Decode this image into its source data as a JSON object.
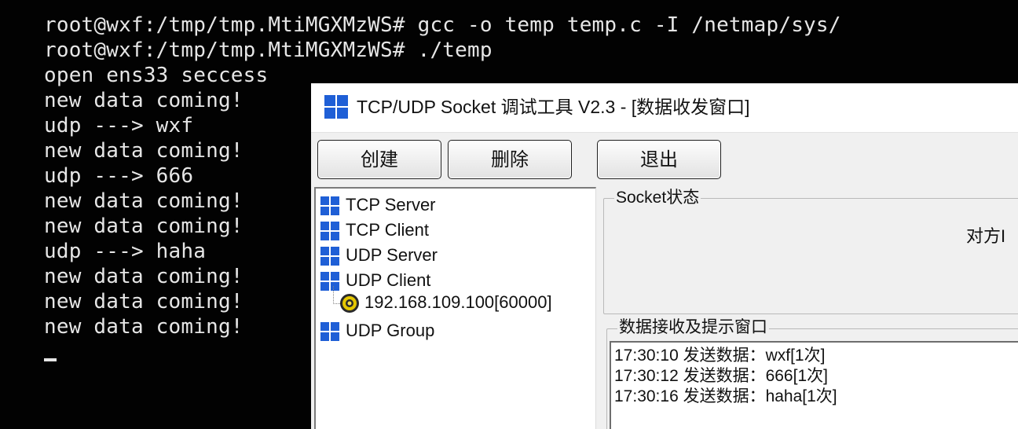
{
  "terminal": {
    "lines": [
      "root@wxf:/tmp/tmp.MtiMGXMzWS# gcc -o temp temp.c -I /netmap/sys/",
      "root@wxf:/tmp/tmp.MtiMGXMzWS# ./temp",
      "open ens33 seccess",
      "new data coming!",
      "udp ---> wxf",
      "new data coming!",
      "udp ---> 666",
      "new data coming!",
      "new data coming!",
      "udp ---> haha",
      "new data coming!",
      "new data coming!",
      "new data coming!"
    ]
  },
  "window": {
    "title": "TCP/UDP Socket 调试工具 V2.3 - [数据收发窗口]",
    "icon": "windows-grid-icon"
  },
  "toolbar": {
    "create_label": "创建",
    "delete_label": "删除",
    "exit_label": "退出"
  },
  "tree": {
    "items": [
      {
        "label": "TCP Server",
        "icon": "windows-grid-icon"
      },
      {
        "label": "TCP Client",
        "icon": "windows-grid-icon"
      },
      {
        "label": "UDP Server",
        "icon": "windows-grid-icon"
      },
      {
        "label": "UDP Client",
        "icon": "windows-grid-icon"
      },
      {
        "label": "UDP Group",
        "icon": "windows-grid-icon"
      }
    ],
    "child": {
      "label": "192.168.109.100[60000]",
      "icon": "connection-node-icon"
    }
  },
  "status_panel": {
    "legend": "Socket状态",
    "peer_label": "对方I"
  },
  "receive_panel": {
    "legend": "数据接收及提示窗口",
    "log": [
      "17:30:10 发送数据：wxf[1次]",
      "17:30:12 发送数据：666[1次]",
      "17:30:16 发送数据：haha[1次]"
    ]
  },
  "colors": {
    "terminal_bg": "#020202",
    "terminal_fg": "#e6e6e6",
    "window_bg": "#f0f0f0",
    "icon_blue": "#1f5fd6"
  }
}
